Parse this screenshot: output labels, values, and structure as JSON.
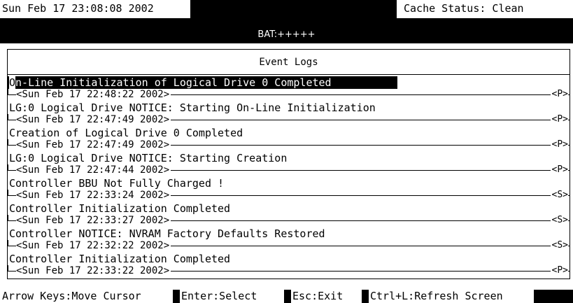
{
  "header": {
    "datetime": "Sun Feb 17 23:08:08 2002",
    "cache_status": "Cache Status: Clean",
    "battery": "BAT:+++++"
  },
  "panel": {
    "title": "Event Logs",
    "events": [
      {
        "cursor": "O",
        "message": "n-Line Initialization of Logical Drive 0 Completed",
        "timestamp": "<Sun Feb 17 22:48:22 2002>",
        "tag": "<P>"
      },
      {
        "cursor": "",
        "message": "LG:0 Logical Drive NOTICE: Starting On-Line Initialization",
        "timestamp": "<Sun Feb 17 22:47:49 2002>",
        "tag": "<P>"
      },
      {
        "cursor": "",
        "message": "Creation of Logical Drive 0 Completed",
        "timestamp": "<Sun Feb 17 22:47:49 2002>",
        "tag": "<P>"
      },
      {
        "cursor": "",
        "message": "LG:0 Logical Drive NOTICE: Starting Creation",
        "timestamp": "<Sun Feb 17 22:47:44 2002>",
        "tag": "<P>"
      },
      {
        "cursor": "",
        "message": "Controller BBU Not Fully Charged !",
        "timestamp": "<Sun Feb 17 22:33:24 2002>",
        "tag": "<S>"
      },
      {
        "cursor": "",
        "message": "Controller Initialization Completed",
        "timestamp": "<Sun Feb 17 22:33:27 2002>",
        "tag": "<S>"
      },
      {
        "cursor": "",
        "message": "Controller NOTICE: NVRAM Factory Defaults Restored",
        "timestamp": "<Sun Feb 17 22:32:22 2002>",
        "tag": "<S>"
      },
      {
        "cursor": "",
        "message": "Controller Initialization Completed",
        "timestamp": "<Sun Feb 17 22:33:22 2002>",
        "tag": "<P>"
      }
    ]
  },
  "footer": {
    "hints": [
      "Arrow Keys:Move Cursor",
      "Enter:Select",
      "Esc:Exit",
      "Ctrl+L:Refresh Screen"
    ]
  },
  "colors": {
    "background": "#ffffff",
    "foreground": "#000000",
    "highlight": "#000000"
  }
}
